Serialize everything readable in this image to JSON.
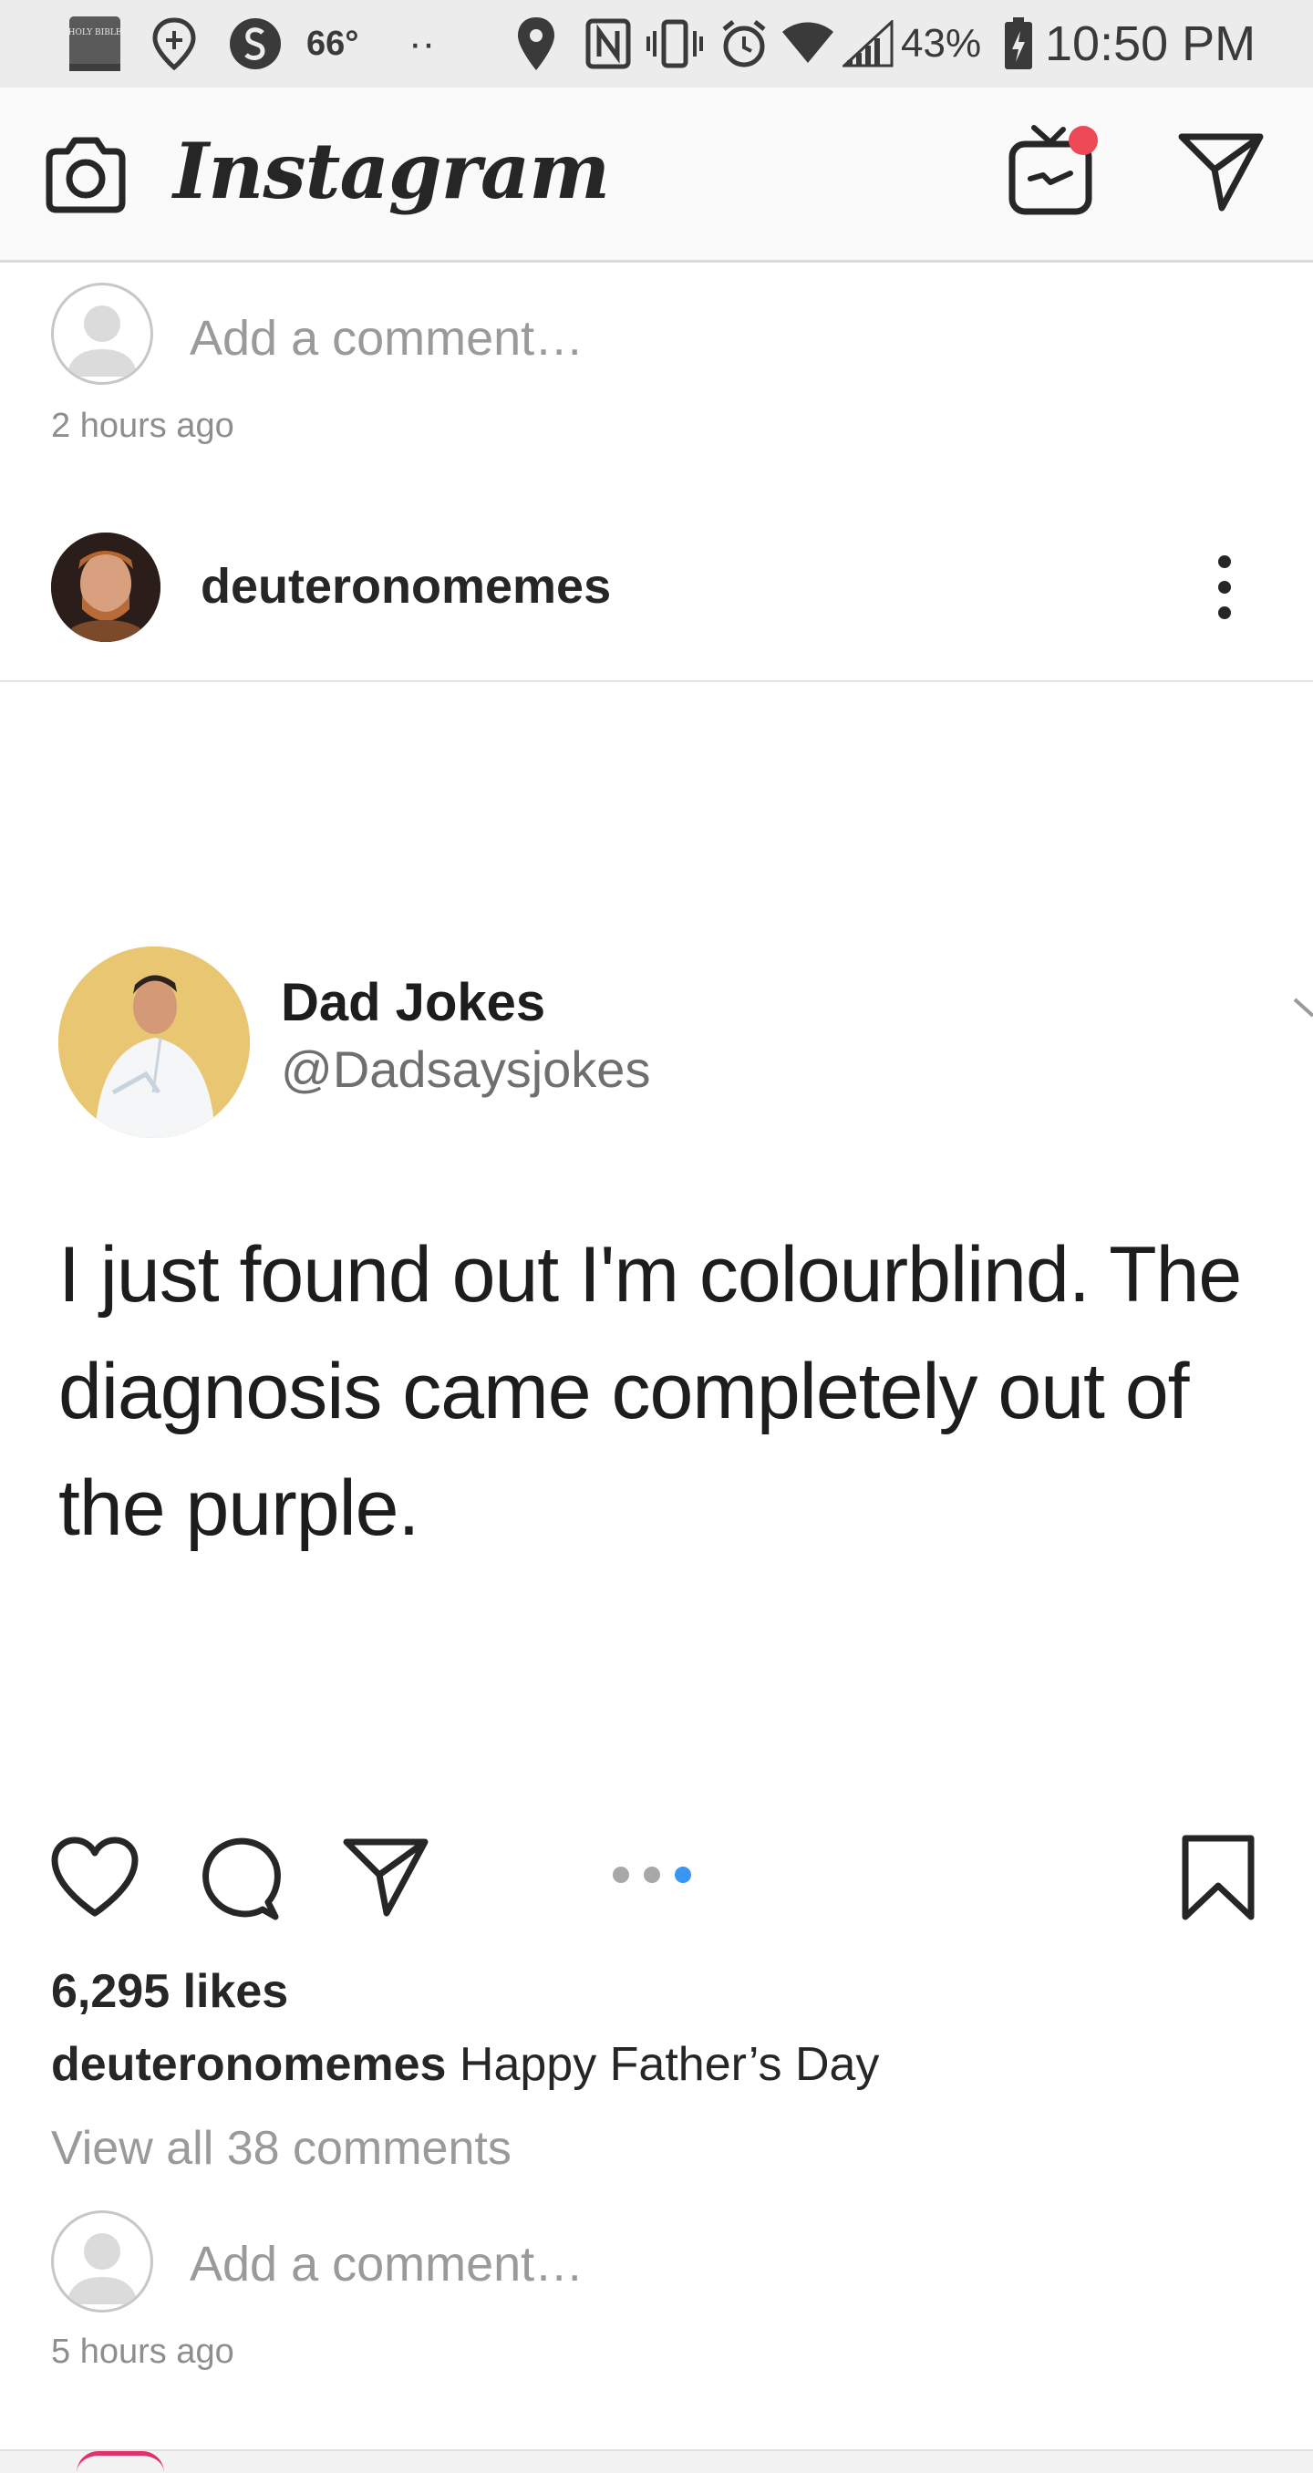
{
  "status_bar": {
    "bible_icon_text": "HOLY BIBLE",
    "temperature": "66°",
    "dots": "··",
    "battery": "43%",
    "time": "10:50 PM"
  },
  "header": {
    "app_title": "Instagram",
    "icons": [
      "camera-icon",
      "igtv-icon",
      "direct-message-icon"
    ],
    "notification_color": "#ed4956"
  },
  "previous_post_footer": {
    "comment_placeholder": "Add a comment…",
    "timestamp": "2 hours ago"
  },
  "post": {
    "username": "deuteronomemes",
    "image": {
      "tweet_author": "Dad Jokes",
      "tweet_handle": "@Dadsaysjokes",
      "tweet_text": "I just found out I'm colourblind. The diagnosis came completely out of the purple."
    },
    "carousel": {
      "total": 3,
      "active_index": 3,
      "active_color": "#3897f0"
    },
    "likes": "6,295 likes",
    "caption_user": "deuteronomemes",
    "caption_text": "Happy Father’s Day",
    "view_comments": "View all 38 comments",
    "comment_placeholder": "Add a comment…",
    "timestamp": "5 hours ago"
  }
}
